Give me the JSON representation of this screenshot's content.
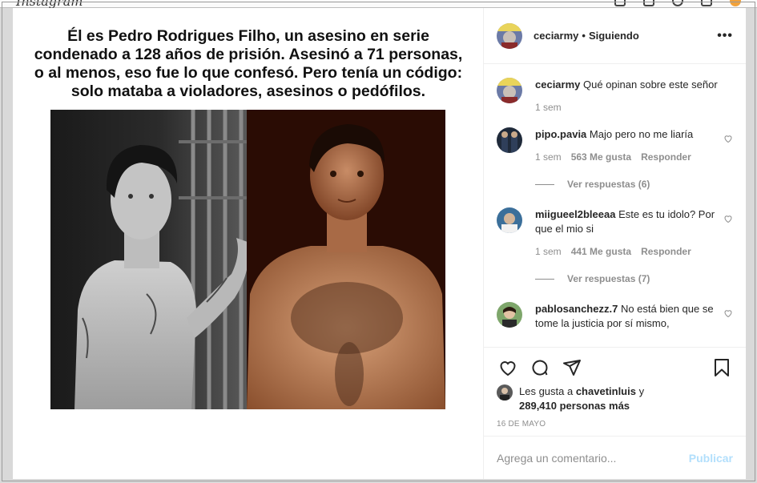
{
  "app": {
    "logo_text": "Instagram"
  },
  "post": {
    "caption_lines": [
      "Él es Pedro Rodrigues Filho, un asesino en serie",
      "condenado a 128 años de prisión. Asesinó a 71 personas,",
      "o al menos, eso fue lo que confesó. Pero tenía un código:",
      "solo mataba a violadores, asesinos o pedófilos."
    ]
  },
  "header": {
    "username": "ceciarmy",
    "separator": "•",
    "follow_status": "Siguiendo",
    "more": "•••"
  },
  "comments": [
    {
      "username": "ceciarmy",
      "text": "Qué opinan sobre este señor",
      "time": "1 sem",
      "likes": "",
      "reply": "",
      "view_replies": ""
    },
    {
      "username": "pipo.pavia",
      "text": "Majo pero no me liaría",
      "time": "1 sem",
      "likes": "563 Me gusta",
      "reply": "Responder",
      "view_replies": "Ver respuestas (6)"
    },
    {
      "username": "miigueel2bleeaa",
      "text": "Este es tu idolo? Por que el mio si",
      "time": "1 sem",
      "likes": "441 Me gusta",
      "reply": "Responder",
      "view_replies": "Ver respuestas (7)"
    },
    {
      "username": "pablosanchezz.7",
      "text": "No está bien que se tome la justicia por sí mismo,",
      "time": "",
      "likes": "",
      "reply": "",
      "view_replies": ""
    }
  ],
  "likes_summary": {
    "prefix": "Les gusta a ",
    "user": "chavetinluis",
    "middle": " y",
    "count": "289,410 personas más"
  },
  "date": "16 DE MAYO",
  "comment_input": {
    "placeholder": "Agrega un comentario..."
  },
  "publish_label": "Publicar",
  "colors": {
    "accent_disabled": "#b2dffc",
    "muted": "#8e8e8e",
    "text": "#262626"
  }
}
